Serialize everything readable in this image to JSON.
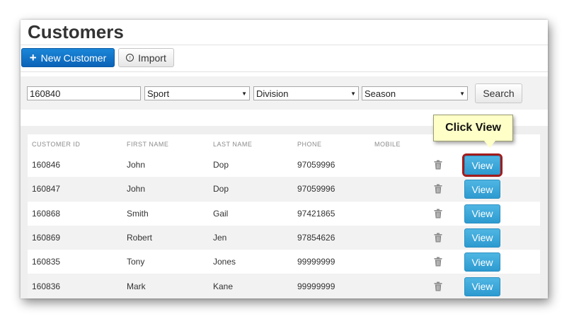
{
  "page": {
    "title": "Customers"
  },
  "toolbar": {
    "new_label": "New Customer",
    "import_label": "Import"
  },
  "filters": {
    "search_value": "160840",
    "sport": "Sport",
    "division": "Division",
    "season": "Season",
    "search_label": "Search"
  },
  "table": {
    "headers": [
      "CUSTOMER ID",
      "FIRST NAME",
      "LAST NAME",
      "PHONE",
      "MOBILE"
    ],
    "view_label": "View",
    "rows": [
      {
        "id": "160846",
        "first": "John",
        "last": "Dop",
        "phone": "97059996",
        "mobile": ""
      },
      {
        "id": "160847",
        "first": "John",
        "last": "Dop",
        "phone": "97059996",
        "mobile": ""
      },
      {
        "id": "160868",
        "first": "Smith",
        "last": "Gail",
        "phone": "97421865",
        "mobile": ""
      },
      {
        "id": "160869",
        "first": "Robert",
        "last": "Jen",
        "phone": "97854626",
        "mobile": ""
      },
      {
        "id": "160835",
        "first": "Tony",
        "last": "Jones",
        "phone": "99999999",
        "mobile": ""
      },
      {
        "id": "160836",
        "first": "Mark",
        "last": "Kane",
        "phone": "99999999",
        "mobile": ""
      }
    ]
  },
  "callout": {
    "text": "Click View"
  },
  "icons": {
    "new": "plus-icon",
    "import": "import-icon",
    "delete": "trash-icon",
    "dropdown": "caret-down-icon"
  },
  "colors": {
    "primary": "#0b63b7",
    "view_button": "#3ba7da",
    "highlight": "#a21c1c",
    "callout_bg": "#ffffc8"
  }
}
